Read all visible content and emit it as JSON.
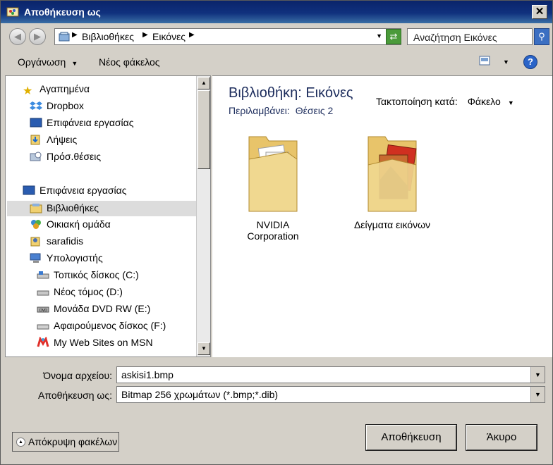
{
  "window": {
    "title": "Αποθήκευση ως",
    "close_glyph": "✕"
  },
  "address": {
    "path": [
      "Βιβλιοθήκες",
      "Εικόνες"
    ],
    "search_placeholder": "Αναζήτηση Εικόνες",
    "back_glyph": "◀",
    "forward_glyph": "▶",
    "refresh_glyph": "⇄",
    "search_glyph": "⚲"
  },
  "toolbar": {
    "organize": "Οργάνωση",
    "new_folder": "Νέος φάκελος",
    "help": "?"
  },
  "nav": {
    "items": [
      {
        "label": "Αγαπημένα",
        "icon": "star-icon"
      },
      {
        "label": "Dropbox",
        "icon": "dropbox-icon"
      },
      {
        "label": "Επιφάνεια εργασίας",
        "icon": "desktop-icon"
      },
      {
        "label": "Λήψεις",
        "icon": "downloads-icon"
      },
      {
        "label": "Πρόσ.θέσεις",
        "icon": "recent-places-icon"
      },
      {
        "label": "Επιφάνεια εργασίας",
        "icon": "desktop-icon"
      },
      {
        "label": "Βιβλιοθήκες",
        "icon": "libraries-icon"
      },
      {
        "label": "Οικιακή ομάδα",
        "icon": "homegroup-icon"
      },
      {
        "label": "sarafidis",
        "icon": "user-folder-icon"
      },
      {
        "label": "Υπολογιστής",
        "icon": "computer-icon"
      },
      {
        "label": "Τοπικός δίσκος (C:)",
        "icon": "drive-icon"
      },
      {
        "label": "Νέος τόμος (D:)",
        "icon": "drive-icon"
      },
      {
        "label": "Μονάδα DVD RW (E:)",
        "icon": "dvd-drive-icon"
      },
      {
        "label": "Αφαιρούμενος δίσκος (F:)",
        "icon": "removable-drive-icon"
      },
      {
        "label": "My Web Sites on MSN",
        "icon": "msn-icon"
      }
    ]
  },
  "library": {
    "title": "Βιβλιοθήκη: Εικόνες",
    "includes_label": "Περιλαμβάνει:",
    "includes_value": "Θέσεις 2",
    "arrange_label": "Τακτοποίηση κατά:",
    "arrange_value": "Φάκελο",
    "folders": [
      {
        "line1": "NVIDIA",
        "line2": "Corporation"
      },
      {
        "line1": "Δείγματα εικόνων",
        "line2": ""
      }
    ]
  },
  "form": {
    "filename_label": "Όνομα αρχείου:",
    "filename_value": "askisi1.bmp",
    "savetype_label": "Αποθήκευση ως:",
    "savetype_value": "Bitmap 256 χρωμάτων (*.bmp;*.dib)",
    "hide_folders": "Απόκρυψη φακέλων",
    "save_button": "Αποθήκευση",
    "cancel_button": "Άκυρο"
  },
  "colors": {
    "title_bar": "#0a246a",
    "selection": "#dcdcdc",
    "library_text": "#1c2c5c"
  }
}
